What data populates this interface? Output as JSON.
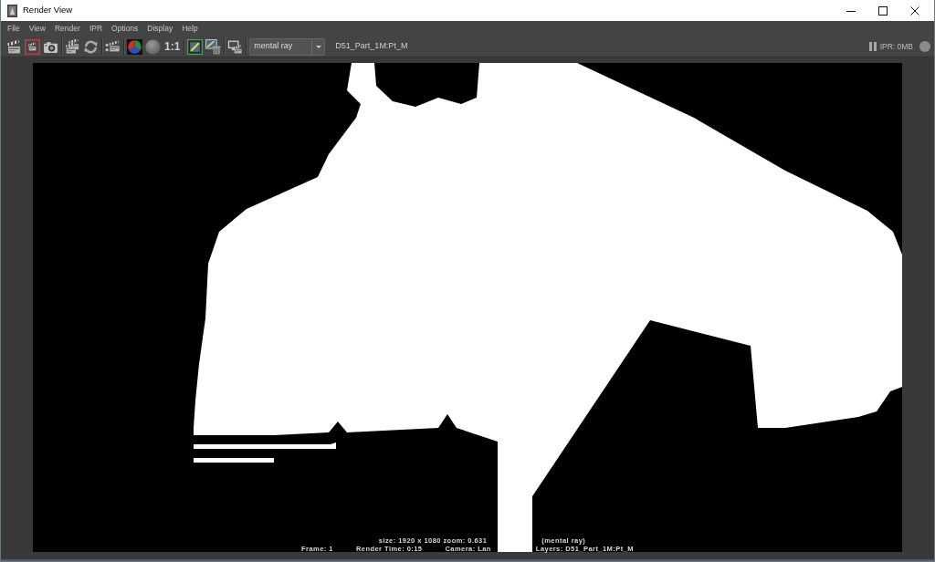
{
  "window": {
    "title": "Render View"
  },
  "menu": [
    {
      "label": "File"
    },
    {
      "label": "View"
    },
    {
      "label": "Render"
    },
    {
      "label": "IPR"
    },
    {
      "label": "Options"
    },
    {
      "label": "Display"
    },
    {
      "label": "Help"
    }
  ],
  "toolbar": {
    "zoom_label": "1:1",
    "renderer": "mental ray",
    "layer": "D51_Part_1M:Pt_M",
    "ipr_memory": "IPR: 0MB"
  },
  "render": {
    "info_lines": [
      {
        "items": [
          "size: 1920 x 1080 zoom: 0.631",
          "(mental ray)"
        ]
      },
      {
        "items": [
          "Frame: 1",
          "Render Time: 0:15",
          "Camera: Lan",
          "Layers: D51_Part_1M:Pt_M"
        ]
      }
    ]
  }
}
